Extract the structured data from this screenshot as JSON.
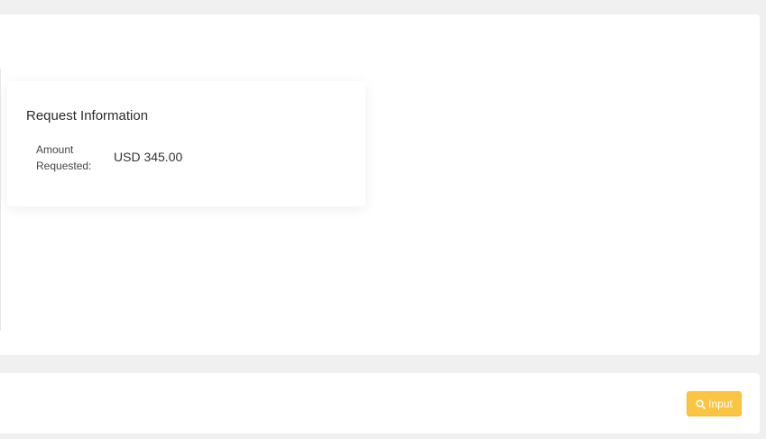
{
  "request_info": {
    "title": "Request Information",
    "amount_label": "Amount Requested:",
    "amount_value": "USD 345.00"
  },
  "footer": {
    "input_button_label": "Input",
    "input_button_icon": "search-icon",
    "input_button_color": "#fbc443"
  }
}
